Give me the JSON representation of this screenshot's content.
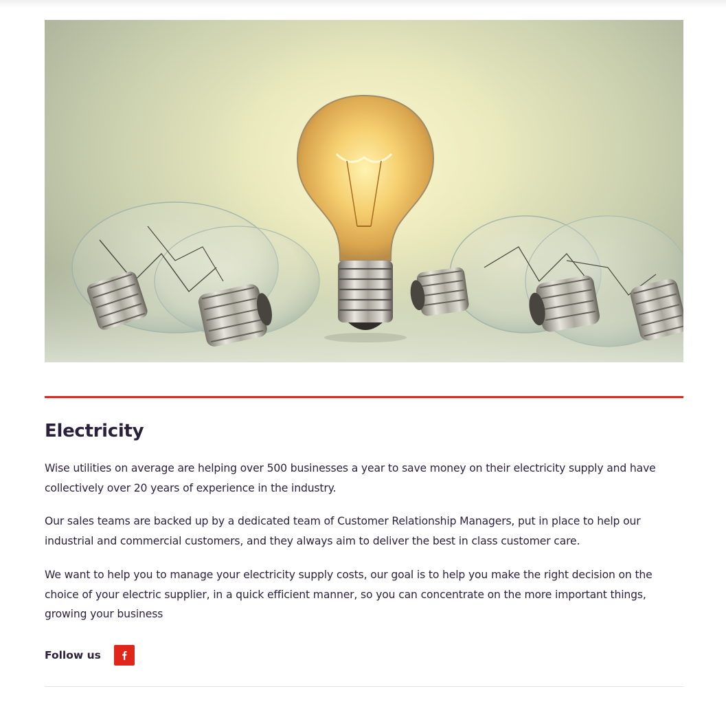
{
  "hero": {
    "image_subject": "lightbulbs-image"
  },
  "article": {
    "title": "Electricity",
    "paragraphs": [
      "Wise utilities on average are helping over 500 businesses a year to save money on their electricity supply and have collectively over 20 years of experience in the industry.",
      "Our sales teams are backed up by a dedicated team of Customer Relationship Managers, put in place to help our industrial and commercial customers, and they always aim to deliver the best in class customer care.",
      "We want to help you to manage your electricity supply costs, our goal is to help you make the right decision on the choice of your electric supplier, in a quick efficient manner, so you can concentrate on the more important things, growing your business"
    ]
  },
  "social": {
    "follow_label": "Follow us",
    "icons": [
      "facebook-icon"
    ]
  },
  "colors": {
    "accent": "#e0261b",
    "text": "#2a1f3d",
    "divider": "#e3e3e3"
  }
}
